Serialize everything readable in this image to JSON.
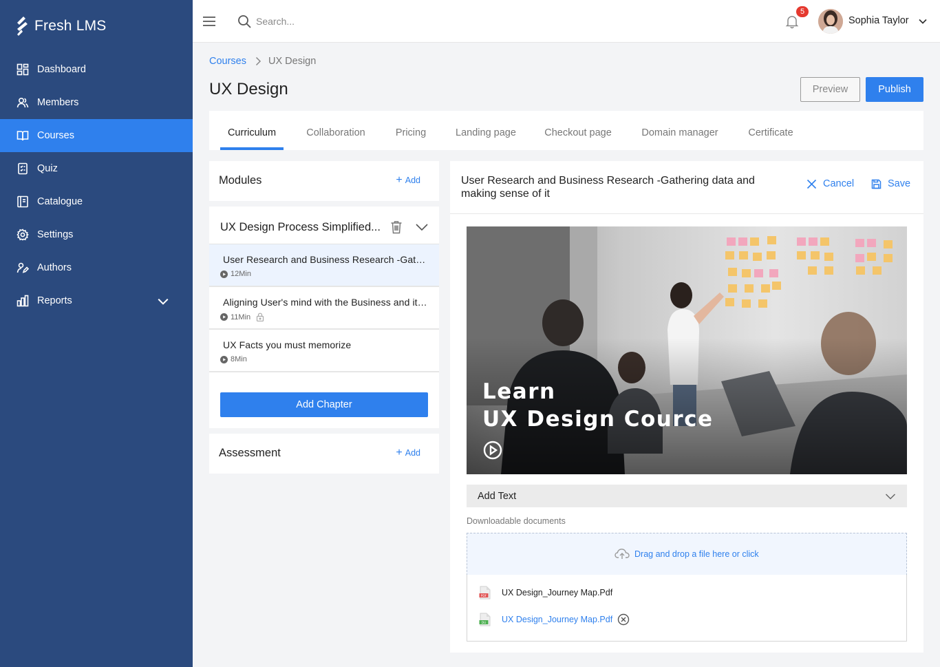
{
  "app": {
    "name": "Fresh LMS"
  },
  "colors": {
    "sidebar": "#2b4a7e",
    "accent": "#2f80ed",
    "badge": "#e5392f"
  },
  "sidebar": {
    "items": [
      {
        "label": "Dashboard",
        "icon": "dashboard-icon"
      },
      {
        "label": "Members",
        "icon": "members-icon"
      },
      {
        "label": "Courses",
        "icon": "book-icon",
        "active": true
      },
      {
        "label": "Quiz",
        "icon": "quiz-icon"
      },
      {
        "label": "Catalogue",
        "icon": "catalogue-icon"
      },
      {
        "label": "Settings",
        "icon": "gear-icon"
      },
      {
        "label": "Authors",
        "icon": "authors-icon"
      },
      {
        "label": "Reports",
        "icon": "bar-chart-icon",
        "expandable": true
      }
    ]
  },
  "topbar": {
    "search_placeholder": "Search...",
    "notification_count": "5",
    "user_name": "Sophia Taylor"
  },
  "breadcrumb": {
    "parent": "Courses",
    "current": "UX Design"
  },
  "page": {
    "title": "UX Design",
    "preview_label": "Preview",
    "publish_label": "Publish"
  },
  "tabs": [
    {
      "label": "Curriculum",
      "active": true
    },
    {
      "label": "Collaboration"
    },
    {
      "label": "Pricing"
    },
    {
      "label": "Landing page"
    },
    {
      "label": "Checkout page"
    },
    {
      "label": "Domain manager"
    },
    {
      "label": "Certificate"
    }
  ],
  "modules": {
    "heading": "Modules",
    "add_label": "Add"
  },
  "chapter": {
    "title": "UX Design Process Simplified...",
    "lessons": [
      {
        "title": "User Research and Business Research -Gathering data and making sense of it",
        "duration": "12Min",
        "active": true,
        "locked": false
      },
      {
        "title": "Aligning User's mind with the Business and its goals",
        "duration": "11Min",
        "active": false,
        "locked": true
      },
      {
        "title": "UX Facts you must memorize",
        "duration": "8Min",
        "active": false,
        "locked": false
      }
    ],
    "add_chapter_label": "Add Chapter"
  },
  "assessment": {
    "heading": "Assessment",
    "add_label": "Add"
  },
  "editor": {
    "lesson_title": "User Research and Business Research -Gathering data and making sense of it",
    "cancel_label": "Cancel",
    "save_label": "Save",
    "video": {
      "line1": "Learn",
      "line2": "UX Design Cource"
    },
    "add_text_label": "Add Text",
    "docs_label": "Downloadable documents",
    "dropzone_label": "Drag and drop a file here or click",
    "files": [
      {
        "name": "UX Design_Journey Map.Pdf",
        "type": "PDF",
        "uploaded": true
      },
      {
        "name": "UX Design_Journey Map.Pdf",
        "type": "DU",
        "uploaded": false
      }
    ]
  }
}
